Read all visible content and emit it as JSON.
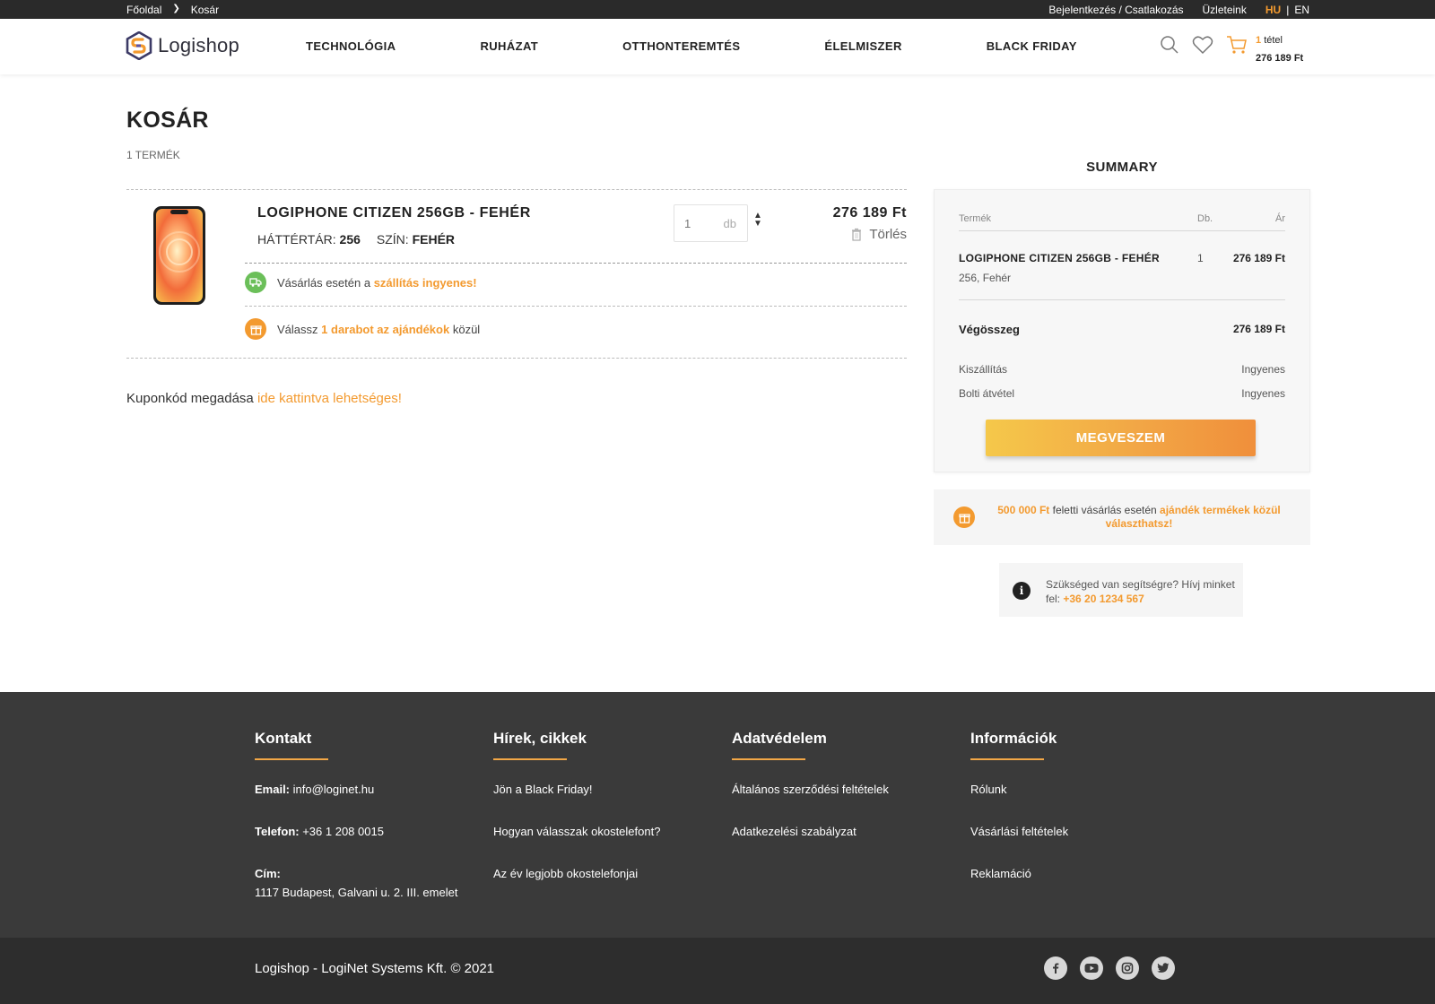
{
  "topbar": {
    "breadcrumb": [
      "Főoldal",
      "Kosár"
    ],
    "login": "Bejelentkezés / Csatlakozás",
    "stores": "Üzleteink",
    "lang_hu": "HU",
    "lang_sep": "|",
    "lang_en": "EN"
  },
  "header": {
    "logo": "Logishop",
    "nav": [
      "TECHNOLÓGIA",
      "RUHÁZAT",
      "OTTHONTEREMTÉS",
      "ÉLELMISZER",
      "BLACK FRIDAY"
    ],
    "cart_count_num": "1",
    "cart_count_word": "tétel",
    "cart_total": "276 189 Ft"
  },
  "page": {
    "title": "KOSÁR",
    "item_count": "1 TERMÉK"
  },
  "cart_item": {
    "name": "LOGIPHONE CITIZEN 256GB - FEHÉR",
    "storage_label": "HÁTTÉRTÁR:",
    "storage_value": "256",
    "color_label": "SZÍN:",
    "color_value": "FEHÉR",
    "qty": "1",
    "qty_unit": "db",
    "price": "276 189 Ft",
    "delete_label": "Törlés"
  },
  "notices": {
    "shipping_pre": "Vásárlás esetén a",
    "shipping_hl": "szállítás ingyenes!",
    "gift_pre": "Válassz",
    "gift_hl": "1 darabot az ajándékok",
    "gift_post": "közül"
  },
  "coupon": {
    "text": "Kuponkód megadása",
    "link": "ide kattintva lehetséges!"
  },
  "summary": {
    "title": "SUMMARY",
    "col_product": "Termék",
    "col_qty": "Db.",
    "col_price": "Ár",
    "product_name": "LOGIPHONE CITIZEN 256GB - FEHÉR",
    "product_sub": "256,  Fehér",
    "product_qty": "1",
    "product_price": "276 189 Ft",
    "total_label": "Végösszeg",
    "total_value": "276 189 Ft",
    "shipping_label": "Kiszállítás",
    "shipping_value": "Ingyenes",
    "pickup_label": "Bolti átvétel",
    "pickup_value": "Ingyenes",
    "buy_button": "MEGVESZEM"
  },
  "gift_promo": {
    "amount": "500 000 Ft",
    "mid": "feletti vásárlás esetén",
    "hl": "ajándék termékek közül választhatsz!"
  },
  "help": {
    "text": "Szükséged van segítségre? Hívj minket fel:",
    "phone": "+36 20 1234 567"
  },
  "footer": {
    "kontakt": {
      "title": "Kontakt",
      "email_label": "Email:",
      "email": "info@loginet.hu",
      "phone_label": "Telefon:",
      "phone": "+36 1 208 0015",
      "address_label": "Cím:",
      "address": "1117 Budapest, Galvani u. 2. III. emelet"
    },
    "news": {
      "title": "Hírek, cikkek",
      "items": [
        "Jön a Black Friday!",
        "Hogyan válasszak okostelefont?",
        "Az év legjobb okostelefonjai"
      ]
    },
    "privacy": {
      "title": "Adatvédelem",
      "items": [
        "Általános szerződési feltételek",
        "Adatkezelési szabályzat"
      ]
    },
    "info": {
      "title": "Információk",
      "items": [
        "Rólunk",
        "Vásárlási feltételek",
        "Reklamáció"
      ]
    },
    "copyright": "Logishop - LogiNet Systems Kft. © 2021",
    "socials": [
      "facebook-icon",
      "youtube-icon",
      "instagram-icon",
      "twitter-icon"
    ]
  },
  "colors": {
    "accent": "#f39a2f",
    "dark": "#2a2a2a",
    "footer": "#3a3a3a",
    "green": "#6bbf59"
  }
}
